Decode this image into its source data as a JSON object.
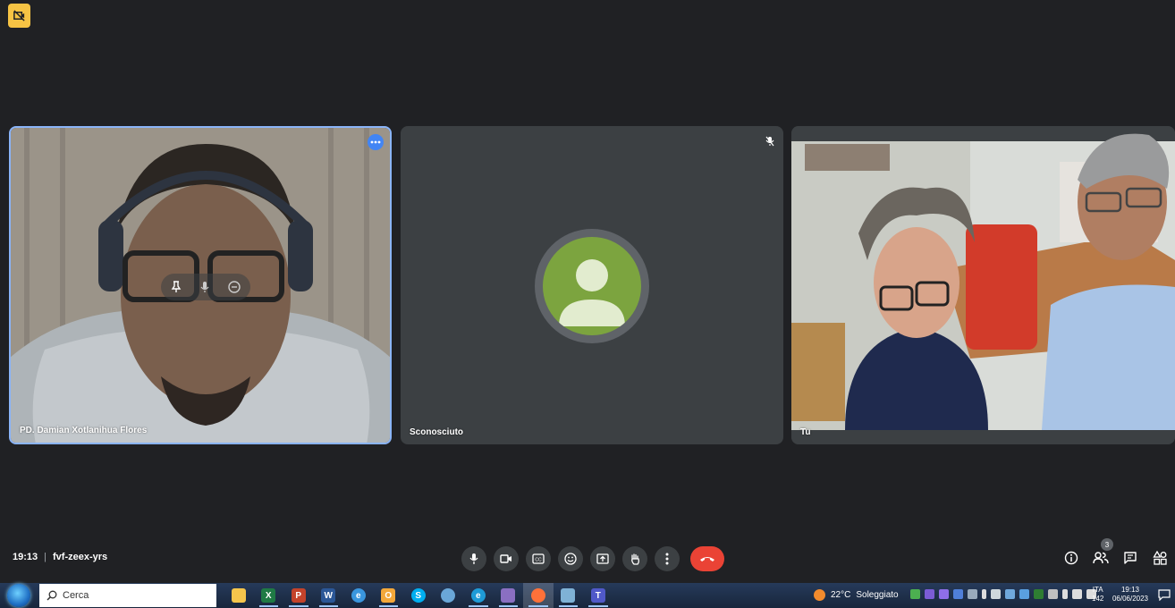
{
  "colors": {
    "background": "#202124",
    "tile": "#3c4043",
    "active_border": "#8ab4f8",
    "hangup": "#ea4335",
    "avatar": "#7ca43f",
    "badge": "#f6c344"
  },
  "recording_badge": {
    "icon": "camera-off-icon"
  },
  "participants": [
    {
      "name": "PD. Damian Xotlanihua Flores",
      "type": "video",
      "active_speaker": true
    },
    {
      "name": "Sconosciuto",
      "type": "avatar",
      "muted": true
    },
    {
      "name": "Tu",
      "type": "video"
    }
  ],
  "meeting": {
    "time": "19:13",
    "separator": "|",
    "code": "fvf-zeex-yrs"
  },
  "controls": [
    "mic-icon",
    "camera-icon",
    "captions-icon",
    "emoji-icon",
    "present-icon",
    "raise-hand-icon",
    "more-icon",
    "hangup-icon"
  ],
  "right_tools": {
    "people_count": "3",
    "icons": [
      "info-icon",
      "people-icon",
      "chat-icon",
      "activities-icon"
    ]
  },
  "taskbar": {
    "search_placeholder": "Cerca",
    "apps": [
      {
        "name": "file-explorer-icon",
        "label": "",
        "color": "#f5c54c"
      },
      {
        "name": "excel-icon",
        "label": "X",
        "color": "#1f7a45"
      },
      {
        "name": "powerpoint-icon",
        "label": "P",
        "color": "#c4432b"
      },
      {
        "name": "word-icon",
        "label": "W",
        "color": "#2b5797"
      },
      {
        "name": "internet-explorer-icon",
        "label": "e",
        "color": "#3a96dd"
      },
      {
        "name": "outlook-icon",
        "label": "O",
        "color": "#f3a83b"
      },
      {
        "name": "skype-icon",
        "label": "S",
        "color": "#00aff0"
      },
      {
        "name": "network-icon",
        "label": "",
        "color": "#6aa7d8"
      },
      {
        "name": "edge-icon",
        "label": "e",
        "color": "#1e9bd7"
      },
      {
        "name": "app-tiles-icon",
        "label": "",
        "color": "#8a6fc2"
      },
      {
        "name": "firefox-icon",
        "label": "",
        "color": "#ff7139"
      },
      {
        "name": "paint-icon",
        "label": "",
        "color": "#7fb2d6"
      },
      {
        "name": "teams-icon",
        "label": "T",
        "color": "#5059c9"
      }
    ],
    "weather": {
      "temperature": "22°C",
      "condition": "Soleggiato"
    },
    "language": "ITA",
    "language_sub": "142",
    "clock_time": "19:13",
    "clock_date": "06/06/2023"
  }
}
